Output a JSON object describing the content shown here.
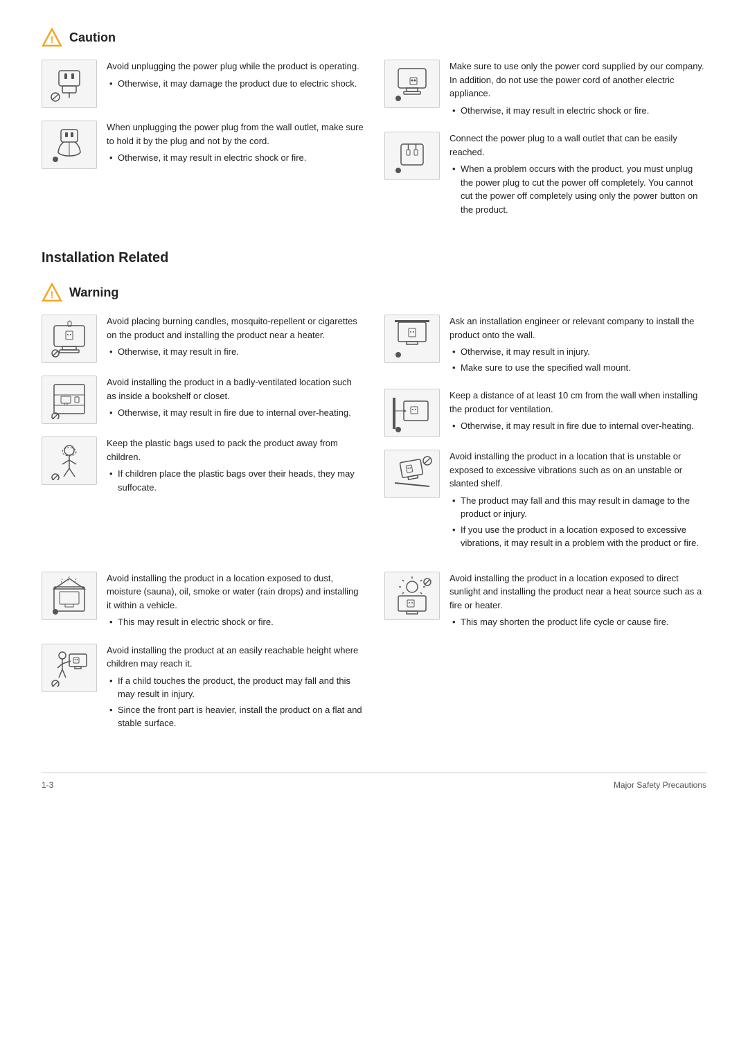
{
  "caution": {
    "title": "Caution",
    "warning_title": "Warning",
    "installation_title": "Installation Related"
  },
  "footer": {
    "page": "1-3",
    "section": "Major Safety Precautions"
  },
  "caution_items_left": [
    {
      "main": "Avoid unplugging the power plug while the product is operating.",
      "bullets": [
        "Otherwise, it may damage the product due to electric shock."
      ],
      "icon_type": "plug_prohibited"
    },
    {
      "main": "When unplugging the power plug from the wall outlet, make sure to hold it by the plug and not by the cord.",
      "bullets": [
        "Otherwise, it may result in electric shock or fire."
      ],
      "icon_type": "unplug_hand"
    }
  ],
  "caution_items_right": [
    {
      "main": "Make sure to use only the power cord supplied by our company. In addition, do not use the power cord of another electric appliance.",
      "bullets": [
        "Otherwise, it may result in electric shock or fire."
      ],
      "icon_type": "power_cord"
    },
    {
      "main": "Connect the power plug to a wall outlet that can be easily reached.",
      "bullets": [
        "When a problem occurs with the product, you must unplug the power plug to cut the power off completely. You cannot cut the power off completely using only the power button on the product."
      ],
      "icon_type": "wall_outlet"
    }
  ],
  "warning_items_left": [
    {
      "main": "Avoid placing burning candles,  mosquito-repellent or cigarettes on the product and installing the product near a heater.",
      "bullets": [
        "Otherwise, it may result in fire."
      ],
      "icon_type": "candles_prohibited"
    },
    {
      "main": "Avoid installing the product in a badly-ventilated location such as inside a bookshelf or closet.",
      "bullets": [
        "Otherwise, it may result in fire due to internal over-heating."
      ],
      "icon_type": "bookshelf_prohibited"
    },
    {
      "main": "Keep the plastic bags used to pack the product away from children.",
      "bullets": [
        "If children place the plastic bags over their heads, they may suffocate."
      ],
      "icon_type": "bag_children"
    }
  ],
  "warning_items_left2": [
    {
      "main": "Avoid installing the product in a location exposed to dust, moisture (sauna), oil, smoke or water (rain drops) and installing it within a vehicle.",
      "bullets": [
        "This may result in electric shock or fire."
      ],
      "icon_type": "moisture_prohibited"
    },
    {
      "main": "Avoid installing the product at an easily reachable height where children may reach it.",
      "bullets": [
        "If a child touches the product, the product may fall and this may result in injury.",
        "Since the front part is heavier, install the product on a flat and stable surface."
      ],
      "icon_type": "child_reach"
    }
  ],
  "warning_items_right": [
    {
      "main": "Ask an installation engineer or relevant company to install the product onto the wall.",
      "bullets": [
        "Otherwise, it may result in injury.",
        "Make sure to use the specified wall mount."
      ],
      "icon_type": "wall_mount"
    },
    {
      "main": "Keep a distance of at least 10 cm from the wall when installing the product for ventilation.",
      "bullets": [
        "Otherwise, it may result in fire due to internal over-heating."
      ],
      "icon_type": "distance"
    },
    {
      "main": "Avoid installing the product in a location that is unstable or exposed to excessive vibrations such as on an unstable or slanted shelf.",
      "bullets": [
        "The product may fall and this may result in damage to the product or injury.",
        "If you use the product in a location exposed to excessive vibrations, it may result in a problem with the product or fire."
      ],
      "icon_type": "vibration"
    }
  ],
  "warning_items_right2": [
    {
      "main": "Avoid installing the product in a location exposed to direct sunlight and installing the product near a heat source such as a fire or heater.",
      "bullets": [
        "This may shorten the product life cycle or cause fire."
      ],
      "icon_type": "sunlight"
    }
  ]
}
